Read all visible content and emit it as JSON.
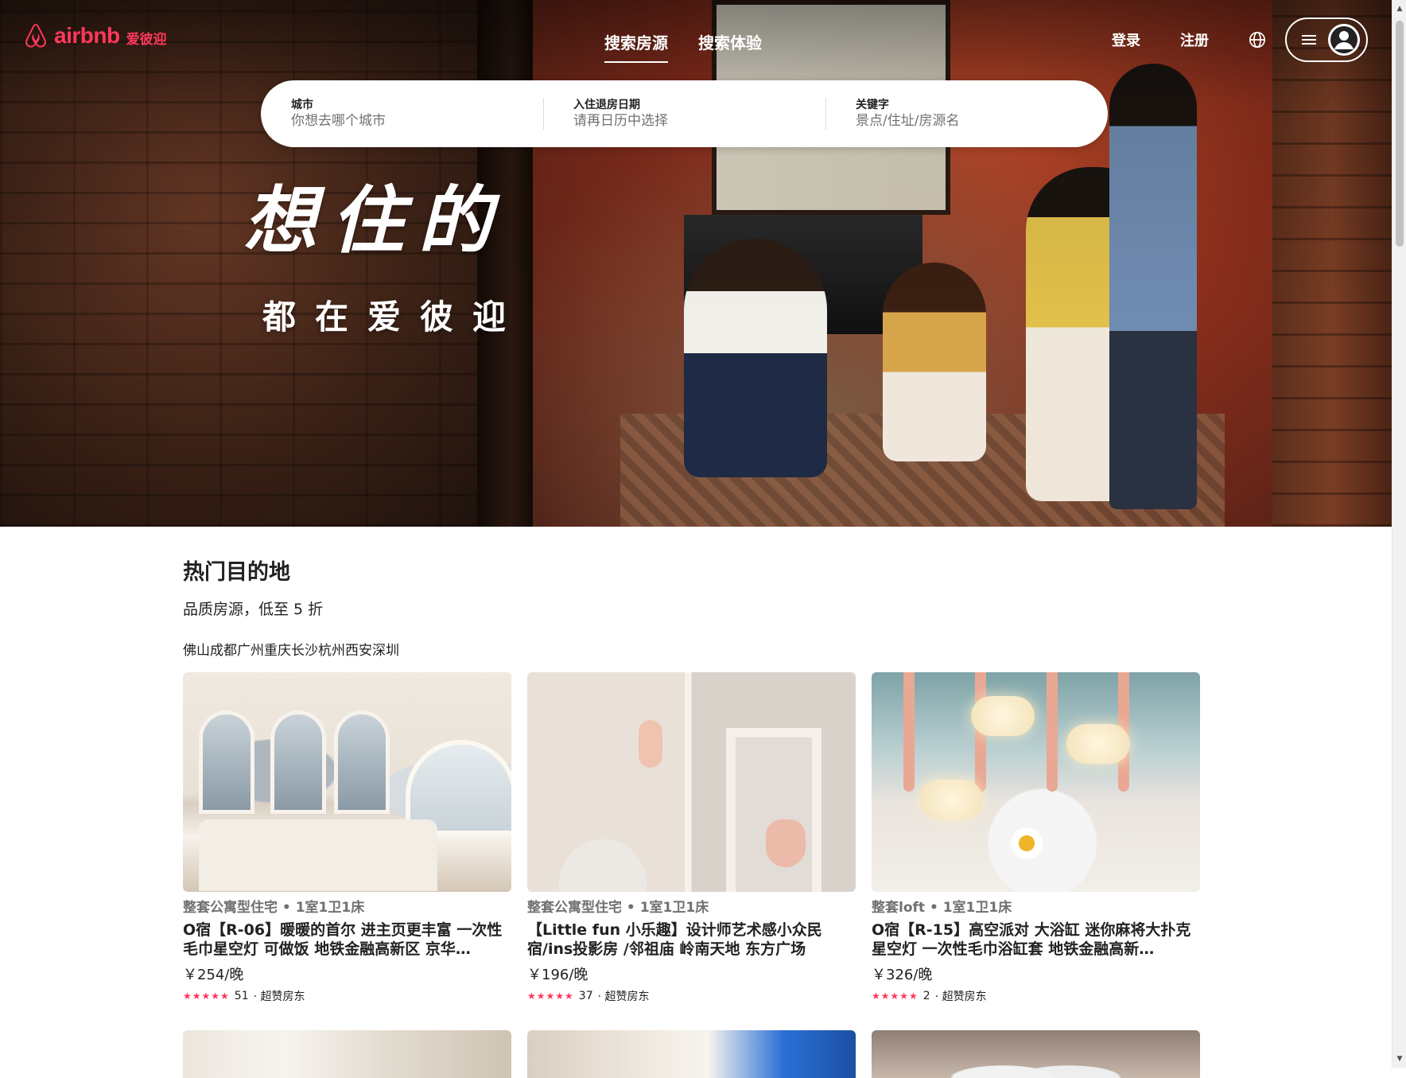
{
  "brand": {
    "name": "airbnb",
    "name_cn": "爱彼迎",
    "color": "#ff385c"
  },
  "nav": {
    "tabs": [
      {
        "label": "搜索房源",
        "active": true
      },
      {
        "label": "搜索体验",
        "active": false
      }
    ],
    "login": "登录",
    "signup": "注册",
    "icons": [
      "globe-icon",
      "menu-icon",
      "user-avatar-icon"
    ]
  },
  "search": {
    "city": {
      "label": "城市",
      "placeholder": "你想去哪个城市"
    },
    "dates": {
      "label": "入住退房日期",
      "placeholder": "请再日历中选择"
    },
    "keyword": {
      "label": "关键字",
      "placeholder": "景点/住址/房源名"
    }
  },
  "hero": {
    "title": "想住的",
    "subtitle": "都在爱彼迎"
  },
  "section": {
    "title": "热门目的地",
    "subtitle": "品质房源，低至 5 折",
    "cities": [
      "佛山",
      "成都",
      "广州",
      "重庆",
      "长沙",
      "杭州",
      "西安",
      "深圳"
    ]
  },
  "listings": [
    {
      "meta": "整套公寓型住宅 • 1室1卫1床",
      "title": "O宿【R-06】暖暖的首尔 进主页更丰富 一次性毛巾星空灯 可做饭 地铁金融高新区 京华…",
      "price": "￥254/晚",
      "stars": "★★★★★",
      "reviews": "51",
      "host": "· 超赞房东"
    },
    {
      "meta": "整套公寓型住宅 • 1室1卫1床",
      "title": "【Little fun 小乐趣】设计师艺术感小众民宿/ins投影房 /邻祖庙 岭南天地 东方广场",
      "price": "￥196/晚",
      "stars": "★★★★★",
      "reviews": "37",
      "host": "· 超赞房东"
    },
    {
      "meta": "整套loft • 1室1卫1床",
      "title": "O宿【R-15】高空派对 大浴缸 迷你麻将大扑克 星空灯 一次性毛巾浴缸套 地铁金融高新…",
      "price": "￥326/晚",
      "stars": "★★★★★",
      "reviews": "2",
      "host": "· 超赞房东"
    }
  ],
  "scrollbar": {
    "up": "▲",
    "down": "▼"
  }
}
